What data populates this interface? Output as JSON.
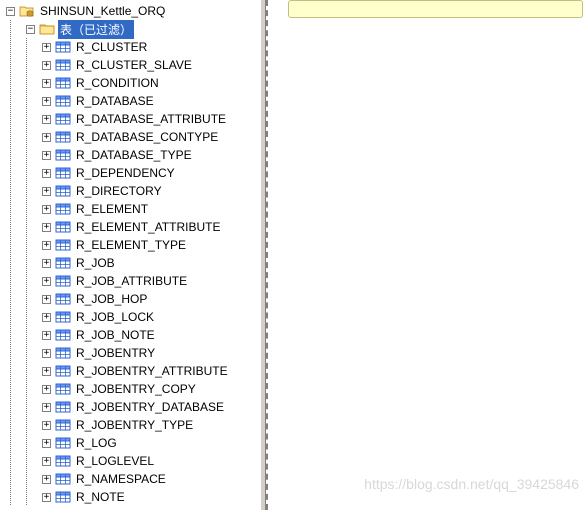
{
  "tree": {
    "root": {
      "label": "SHINSUN_Kettle_ORQ",
      "expanded": true
    },
    "tables_folder": {
      "label": "表（已过滤）",
      "expanded": true,
      "selected": true
    },
    "tables": [
      "R_CLUSTER",
      "R_CLUSTER_SLAVE",
      "R_CONDITION",
      "R_DATABASE",
      "R_DATABASE_ATTRIBUTE",
      "R_DATABASE_CONTYPE",
      "R_DATABASE_TYPE",
      "R_DEPENDENCY",
      "R_DIRECTORY",
      "R_ELEMENT",
      "R_ELEMENT_ATTRIBUTE",
      "R_ELEMENT_TYPE",
      "R_JOB",
      "R_JOB_ATTRIBUTE",
      "R_JOB_HOP",
      "R_JOB_LOCK",
      "R_JOB_NOTE",
      "R_JOBENTRY",
      "R_JOBENTRY_ATTRIBUTE",
      "R_JOBENTRY_COPY",
      "R_JOBENTRY_DATABASE",
      "R_JOBENTRY_TYPE",
      "R_LOG",
      "R_LOGLEVEL",
      "R_NAMESPACE",
      "R_NOTE"
    ]
  },
  "expander": {
    "plus": "+",
    "minus": "−"
  },
  "watermark": "https://blog.csdn.net/qq_39425846"
}
